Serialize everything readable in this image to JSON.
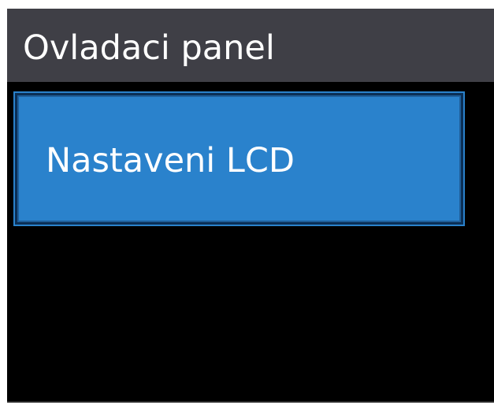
{
  "header": {
    "title": "Ovladaci panel"
  },
  "menu": {
    "items": [
      {
        "label": "Nastaveni LCD"
      }
    ]
  },
  "colors": {
    "screen_background": "#000000",
    "header_background": "#3f3f46",
    "selected_item_background": "#2a82cc",
    "text": "#ffffff"
  }
}
